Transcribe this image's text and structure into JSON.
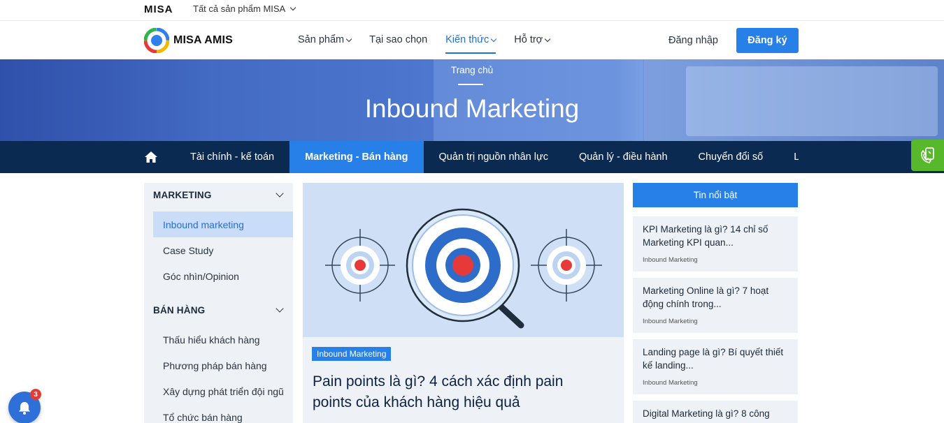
{
  "topbar": {
    "brand": "MISA",
    "all_products": "Tất cả sản phẩm MISA"
  },
  "header": {
    "brand": "MISA AMIS",
    "nav": [
      {
        "label": "Sản phẩm",
        "dropdown": true,
        "active": false
      },
      {
        "label": "Tại sao chọn",
        "dropdown": false,
        "active": false
      },
      {
        "label": "Kiến thức",
        "dropdown": true,
        "active": true
      },
      {
        "label": "Hỗ trợ",
        "dropdown": true,
        "active": false
      }
    ],
    "login": "Đăng nhập",
    "signup": "Đăng ký"
  },
  "hero": {
    "breadcrumb": "Trang chủ",
    "title": "Inbound Marketing"
  },
  "categories": [
    {
      "label": "Tài chính - kế toán",
      "active": false
    },
    {
      "label": "Marketing - Bán hàng",
      "active": true
    },
    {
      "label": "Quản trị nguồn nhân lực",
      "active": false
    },
    {
      "label": "Quản lý - điều hành",
      "active": false
    },
    {
      "label": "Chuyển đổi số",
      "active": false
    },
    {
      "label": "Lịch",
      "active": false
    }
  ],
  "sidebar": {
    "groups": [
      {
        "title": "MARKETING",
        "items": [
          {
            "label": "Inbound marketing",
            "active": true
          },
          {
            "label": "Case Study",
            "active": false
          },
          {
            "label": "Góc nhìn/Opinion",
            "active": false
          }
        ]
      },
      {
        "title": "BÁN HÀNG",
        "items": [
          {
            "label": "Thấu hiểu khách hàng",
            "active": false
          },
          {
            "label": "Phương pháp bán hàng",
            "active": false
          },
          {
            "label": "Xây dựng phát triển đội ngũ",
            "active": false
          },
          {
            "label": "Tổ chức bán hàng",
            "active": false
          }
        ]
      }
    ]
  },
  "featured": {
    "tag": "Inbound Marketing",
    "title": "Pain points là gì? 4 cách xác định pain points của khách hàng hiệu quả"
  },
  "highlights": {
    "title": "Tin nổi bật",
    "items": [
      {
        "title": "KPI Marketing là gì? 14 chỉ số Marketing KPI quan...",
        "tag": "Inbound Marketing"
      },
      {
        "title": "Marketing Online là gì? 7 hoạt động chính trong...",
        "tag": "Inbound Marketing"
      },
      {
        "title": "Landing page là gì? Bí quyết thiết kế landing...",
        "tag": "Inbound Marketing"
      },
      {
        "title": "Digital Marketing là gì? 8 công",
        "tag": ""
      }
    ]
  },
  "notification": {
    "count": "3"
  },
  "colors": {
    "primary": "#2780e8",
    "navy": "#0b2a52",
    "phone_green": "#56b82a",
    "badge_red": "#e53935"
  }
}
